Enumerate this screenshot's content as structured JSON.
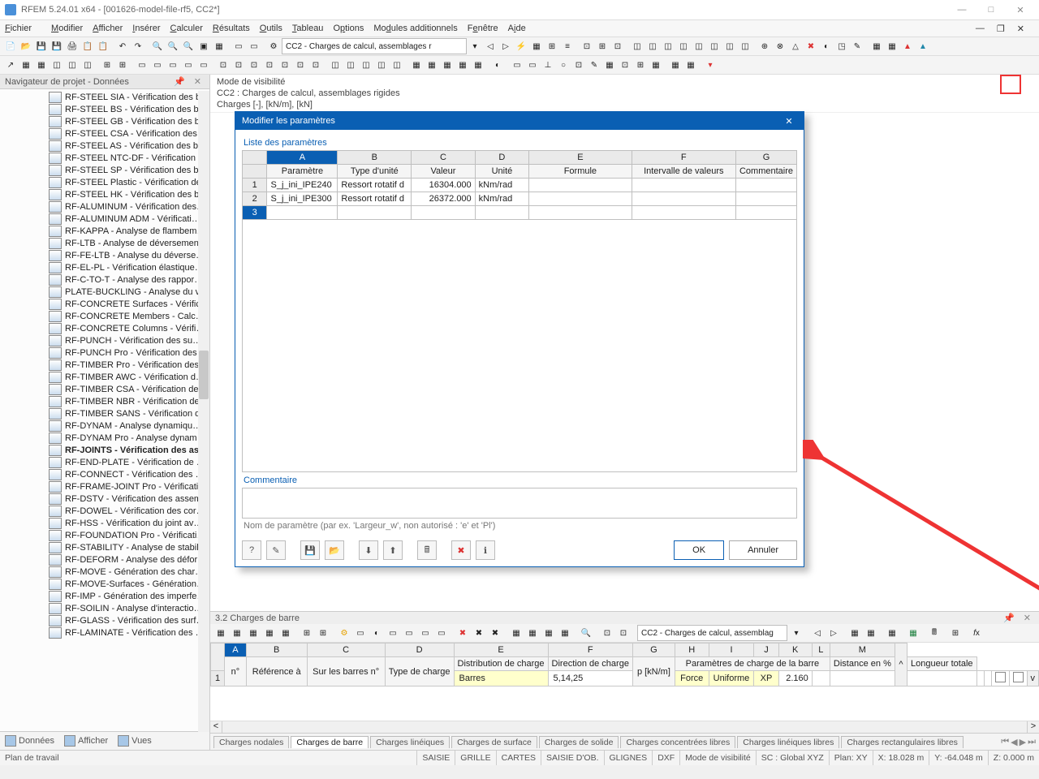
{
  "window": {
    "title": "RFEM 5.24.01 x64 - [001626-model-file-rf5, CC2*]",
    "min": "—",
    "max": "□",
    "close": "✕"
  },
  "menu": {
    "items": [
      "Fichier",
      "Modifier",
      "Afficher",
      "Insérer",
      "Calculer",
      "Résultats",
      "Outils",
      "Tableau",
      "Options",
      "Modules additionnels",
      "Fenêtre",
      "Aide"
    ]
  },
  "toolbar_combo": "CC2 - Charges de calcul, assemblages r",
  "sidebar": {
    "title": "Navigateur de projet - Données",
    "tabs": [
      "Données",
      "Afficher",
      "Vues"
    ],
    "items": [
      "RF-STEEL SIA - Vérification des b…",
      "RF-STEEL BS - Vérification des ba…",
      "RF-STEEL GB - Vérification des b…",
      "RF-STEEL CSA - Vérification des l…",
      "RF-STEEL AS - Vérification des ba…",
      "RF-STEEL NTC-DF - Vérification …",
      "RF-STEEL SP - Vérification des ba…",
      "RF-STEEL Plastic - Vérification de…",
      "RF-STEEL HK - Vérification des b…",
      "RF-ALUMINUM - Vérification des…",
      "RF-ALUMINUM ADM - Vérificati…",
      "RF-KAPPA - Analyse de flambem…",
      "RF-LTB - Analyse de déversemen…",
      "RF-FE-LTB - Analyse du déverse…",
      "RF-EL-PL - Vérification élastique…",
      "RF-C-TO-T - Analyse des rappor…",
      "PLATE-BUCKLING - Analyse du v…",
      "RF-CONCRETE Surfaces - Vérific…",
      "RF-CONCRETE Members - Calc…",
      "RF-CONCRETE Columns - Vérifi…",
      "RF-PUNCH - Vérification des su…",
      "RF-PUNCH Pro - Vérification des…",
      "RF-TIMBER Pro - Vérification des…",
      "RF-TIMBER AWC - Vérification d…",
      "RF-TIMBER CSA - Vérification de…",
      "RF-TIMBER NBR - Vérification de…",
      "RF-TIMBER SANS - Vérification d…",
      "RF-DYNAM - Analyse dynamiqu…",
      "RF-DYNAM Pro - Analyse dynam…",
      "RF-JOINTS - Vérification des as…",
      "RF-END-PLATE - Vérification de …",
      "RF-CONNECT - Vérification des …",
      "RF-FRAME-JOINT Pro - Vérificati…",
      "RF-DSTV - Vérification des assem…",
      "RF-DOWEL - Vérification des cor…",
      "RF-HSS - Vérification du joint av…",
      "RF-FOUNDATION Pro - Vérificati…",
      "RF-STABILITY - Analyse de stabil…",
      "RF-DEFORM - Analyse des défor…",
      "RF-MOVE - Génération des char…",
      "RF-MOVE-Surfaces - Génération…",
      "RF-IMP - Génération des imperfe…",
      "RF-SOILIN - Analyse d'interactio…",
      "RF-GLASS - Vérification des surf…",
      "RF-LAMINATE - Vérification des …"
    ],
    "bold_index": 29
  },
  "info": {
    "l1": "Mode de visibilité",
    "l2": "CC2 : Charges de calcul, assemblages rigides",
    "l3": "Charges [-], [kN/m], [kN]"
  },
  "dialog": {
    "title": "Modifier les paramètres",
    "section": "Liste des paramètres",
    "cols_letters": [
      "A",
      "B",
      "C",
      "D",
      "E",
      "F",
      "G"
    ],
    "cols": [
      "Paramètre",
      "Type d'unité",
      "Valeur",
      "Unité",
      "Formule",
      "Intervalle de valeurs",
      "Commentaire"
    ],
    "rows": [
      {
        "n": "1",
        "a": "S_j_ini_IPE240",
        "b": "Ressort rotatif d",
        "c": "16304.000",
        "d": "kNm/rad",
        "e": "",
        "f": "",
        "g": ""
      },
      {
        "n": "2",
        "a": "S_j_ini_IPE300",
        "b": "Ressort rotatif d",
        "c": "26372.000",
        "d": "kNm/rad",
        "e": "",
        "f": "",
        "g": ""
      },
      {
        "n": "3",
        "a": "",
        "b": "",
        "c": "",
        "d": "",
        "e": "",
        "f": "",
        "g": ""
      }
    ],
    "comment_label": "Commentaire",
    "hint": "Nom de paramètre (par ex. 'Largeur_w', non autorisé : 'e' et 'Pl')",
    "ok": "OK",
    "cancel": "Annuler"
  },
  "bottom": {
    "title": "3.2 Charges de barre",
    "combo": "CC2 - Charges de calcul, assemblag",
    "letters": [
      "A",
      "B",
      "C",
      "D",
      "E",
      "F",
      "G",
      "H",
      "I",
      "J",
      "K",
      "L",
      "M"
    ],
    "hdr": {
      "n": "n°",
      "ref": "Référence à",
      "bars": "Sur les barres n°",
      "type": "Type de charge",
      "dist": "Distribution de charge",
      "dir": "Direction de charge",
      "p": "p [kN/m]",
      "params": "Paramètres de charge de la barre",
      "distpc": "Distance en %",
      "len": "Longueur totale"
    },
    "row": {
      "n": "1",
      "ref": "Barres",
      "bars": "5,14,25",
      "type": "Force",
      "dist": "Uniforme",
      "dir": "XP",
      "p": "2.160"
    },
    "tabs": [
      "Charges nodales",
      "Charges de barre",
      "Charges linéiques",
      "Charges de surface",
      "Charges de solide",
      "Charges concentrées libres",
      "Charges linéiques libres",
      "Charges rectangulaires libres"
    ],
    "active_tab": 1
  },
  "status": {
    "left": "Plan de travail",
    "cells": [
      "SAISIE",
      "GRILLE",
      "CARTES",
      "SAISIE D'OB.",
      "GLIGNES",
      "DXF",
      "Mode de visibilité",
      "SC : Global XYZ",
      "Plan: XY",
      "X: 18.028 m",
      "Y: -64.048 m",
      "Z: 0.000 m"
    ]
  }
}
